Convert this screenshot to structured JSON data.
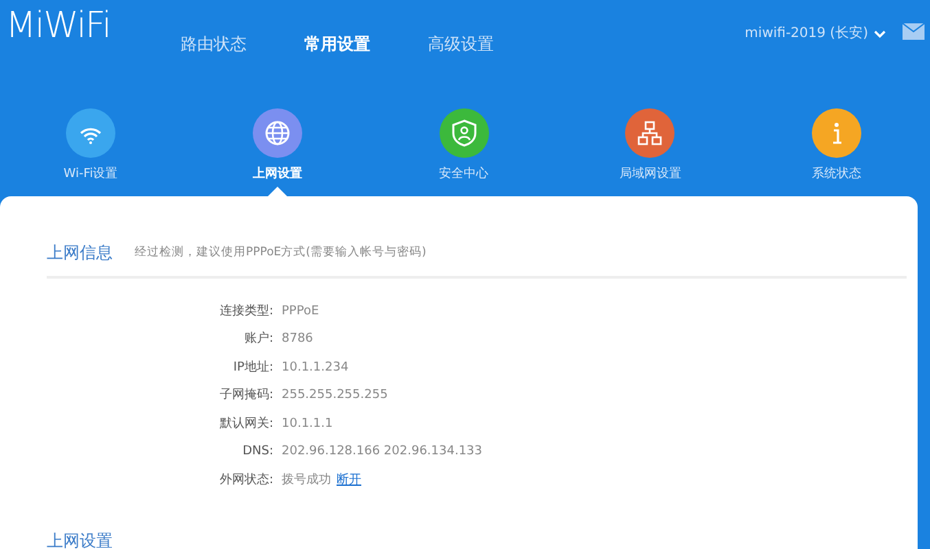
{
  "logo": "MiWiFi",
  "nav": [
    {
      "label": "路由状态",
      "selected": false
    },
    {
      "label": "常用设置",
      "selected": true
    },
    {
      "label": "高级设置",
      "selected": false
    }
  ],
  "router_name": "miwifi-2019 (长安)",
  "tiles": [
    {
      "kind": "wifi",
      "label": "Wi-Fi设置",
      "color": "#3aa6ee",
      "selected": false
    },
    {
      "kind": "globe",
      "label": "上网设置",
      "color": "#7b8ff0",
      "selected": true
    },
    {
      "kind": "shield",
      "label": "安全中心",
      "color": "#3cb93c",
      "selected": false
    },
    {
      "kind": "network",
      "label": "局域网设置",
      "color": "#e0643a",
      "selected": false
    },
    {
      "kind": "info",
      "label": "系统状态",
      "color": "#f5a623",
      "selected": false
    }
  ],
  "section": {
    "title": "上网信息",
    "hint": "经过检测，建议使用PPPoE方式(需要输入帐号与密码)"
  },
  "fields": [
    {
      "label": "连接类型:",
      "value": "PPPoE"
    },
    {
      "label": "账户:",
      "value": "8786"
    },
    {
      "label": "IP地址:",
      "value": "10.1.1.234"
    },
    {
      "label": "子网掩码:",
      "value": "255.255.255.255"
    },
    {
      "label": "默认网关:",
      "value": "10.1.1.1"
    },
    {
      "label": "DNS:",
      "value": "202.96.128.166 202.96.134.133"
    },
    {
      "label": "外网状态:",
      "value": "拨号成功",
      "link": "断开"
    }
  ],
  "next_section": {
    "title": "上网设置"
  }
}
